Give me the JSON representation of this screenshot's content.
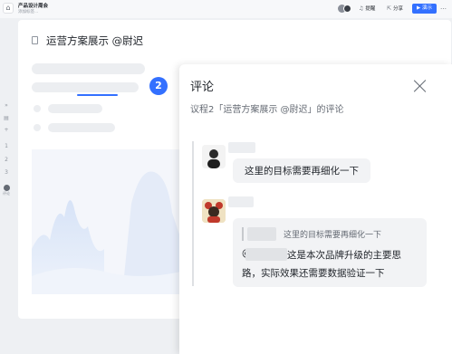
{
  "topbar": {
    "title": "产品设计周会",
    "subtitle": "添加标签...",
    "mention_label": "提醒",
    "share_label": "分享",
    "present_label": "演示",
    "more_label": "…"
  },
  "rail": {
    "items": [
      "»",
      "▤",
      "+",
      "1",
      "2",
      "3"
    ],
    "comment_label": "评论"
  },
  "document": {
    "title": "运营方案展示 @尉迟",
    "badge_number": "2"
  },
  "comments_panel": {
    "title": "评论",
    "subtitle": "议程2「运营方案展示 @尉迟」的评论",
    "comments": [
      {
        "text": "这里的目标需要再细化一下"
      },
      {
        "quote": "这里的目标需要再细化一下",
        "reply_prefix": "@",
        "reply_line1": "这是本次品牌升级的主要思",
        "reply_line2": "路，实际效果还需要数据验证一下"
      }
    ]
  },
  "colors": {
    "accent": "#3370ff",
    "background": "#eef0f3",
    "bubble": "#f2f3f5"
  },
  "icons": [
    "home-icon",
    "bell-icon",
    "share-icon",
    "present-icon",
    "more-icon",
    "doc-icon",
    "close-icon"
  ]
}
